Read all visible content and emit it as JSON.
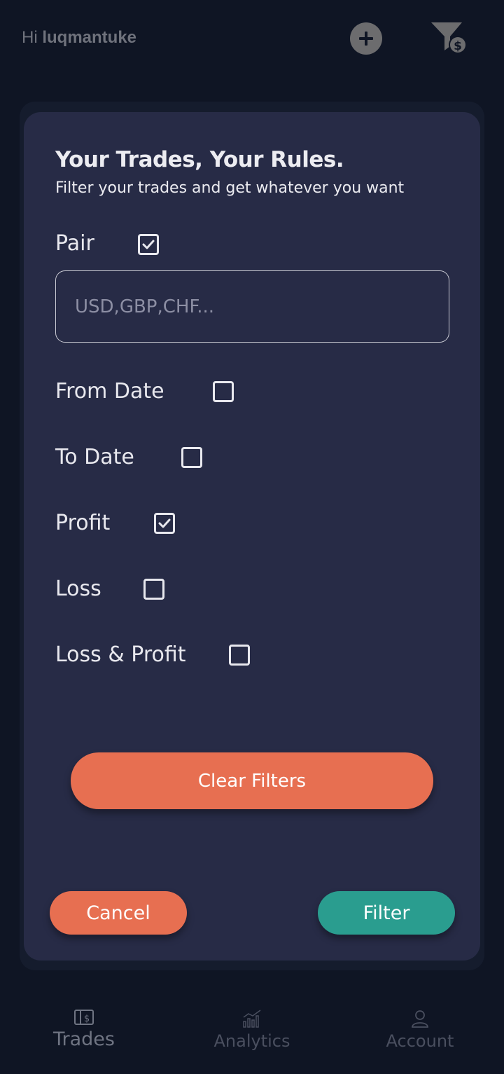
{
  "header": {
    "greeting_prefix": "Hi",
    "username": "luqmantuke",
    "add_icon": "plus-circle-icon",
    "filter_icon": "filter-dollar-icon"
  },
  "modal": {
    "title": "Your Trades, Your Rules.",
    "subtitle": "Filter your trades and get whatever you want",
    "pair": {
      "label": "Pair",
      "checked": true,
      "input_placeholder": "USD,GBP,CHF...",
      "input_value": ""
    },
    "options": [
      {
        "label": "From Date",
        "checked": false
      },
      {
        "label": "To Date",
        "checked": false
      },
      {
        "label": "Profit",
        "checked": true
      },
      {
        "label": "Loss",
        "checked": false
      },
      {
        "label": "Loss & Profit",
        "checked": false
      }
    ],
    "clear_label": "Clear Filters",
    "cancel_label": "Cancel",
    "filter_label": "Filter"
  },
  "nav": {
    "items": [
      {
        "label": "Trades",
        "icon": "wallet-dollar-icon",
        "active": true
      },
      {
        "label": "Analytics",
        "icon": "bar-chart-icon",
        "active": false
      },
      {
        "label": "Account",
        "icon": "user-icon",
        "active": false
      }
    ]
  },
  "colors": {
    "background": "#0f1524",
    "modal": "#272b46",
    "accent_orange": "#e76f51",
    "accent_teal": "#2a9d8f"
  }
}
